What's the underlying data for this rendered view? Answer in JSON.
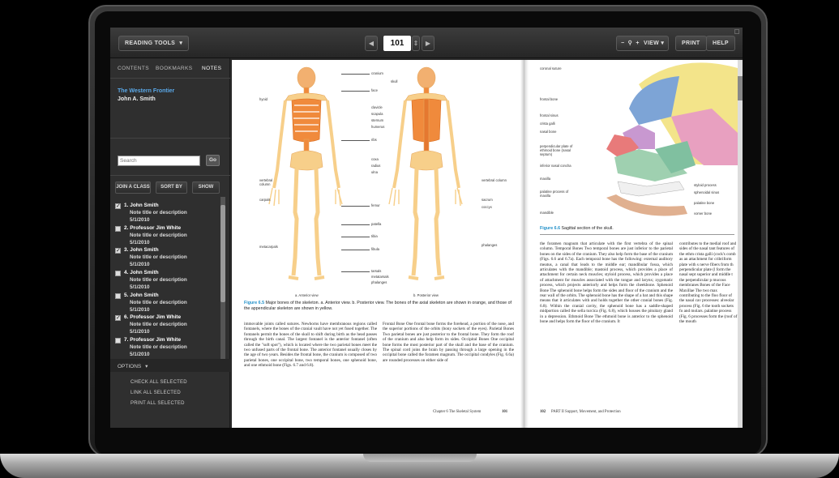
{
  "toolbar": {
    "reading_tools": "READING TOOLS",
    "current_page": "101",
    "view": "VIEW",
    "print": "PRINT",
    "help": "HELP",
    "zoom_out": "−",
    "zoom_in": "+"
  },
  "sidebar": {
    "tabs": [
      "CONTENTS",
      "BOOKMARKS",
      "NOTES"
    ],
    "active_tab": "NOTES",
    "book_title": "The Western Frontier",
    "book_author": "John A. Smith",
    "search_placeholder": "Search",
    "go_label": "Go",
    "buttons": [
      "JOIN A CLASS",
      "SORT BY",
      "SHOW"
    ],
    "notes": [
      {
        "name": "1. John Smith",
        "desc": "Note title or description",
        "date": "5/1/2010",
        "checked": true
      },
      {
        "name": "2. Professor Jim White",
        "desc": "Note title or description",
        "date": "5/1/2010",
        "checked": false
      },
      {
        "name": "3. John Smith",
        "desc": "Note title or description",
        "date": "5/1/2010",
        "checked": true
      },
      {
        "name": "4. John Smith",
        "desc": "Note title or description",
        "date": "5/1/2010",
        "checked": false
      },
      {
        "name": "5. John Smith",
        "desc": "Note title or description",
        "date": "5/1/2010",
        "checked": false
      },
      {
        "name": "6. Professor Jim White",
        "desc": "Note title or description",
        "date": "5/1/2010",
        "checked": true
      },
      {
        "name": "7. Professor Jim White",
        "desc": "Note title or description",
        "date": "5/1/2010",
        "checked": false
      }
    ],
    "options_label": "OPTIONS",
    "option_items": [
      "CHECK ALL SELECTED",
      "LINK ALL SELECTED",
      "PRINT ALL SELECTED"
    ]
  },
  "left_page": {
    "labels_left": [
      "hyoid",
      "vertebral column",
      "carpals",
      "metacarpals"
    ],
    "labels_center": [
      "cranium",
      "skull",
      "face",
      "clavicle",
      "scapula",
      "sternum",
      "humerus",
      "ribs",
      "coxa",
      "radius",
      "ulna",
      "femur",
      "patella",
      "tibia",
      "fibula",
      "tarsals",
      "metatarsals",
      "phalanges"
    ],
    "labels_right": [
      "vertebral column",
      "sacrum",
      "coccyx",
      "phalanges"
    ],
    "view_a": "a. Anterior view",
    "view_b": "b. Posterior view",
    "fig_num": "Figure 6.5",
    "fig_text": "Major bones of the skeleton. a. Anterior view. b. Posterior view. The bones of the axial skeleton are shown in orange, and those of the appendicular skeleton are shown in yellow.",
    "col1": "immovable joints called sutures. Newborns have membranous regions called fontanels, where the bones of the cranial vault have not yet fused together. The fontanels permit the bones of the skull to shift during birth as the head passes through the birth canal. The largest fontanel is the anterior fontanel (often called the \"soft spot\"), which is located where the two parietal bones meet the two unfused parts of the frontal bone. The anterior fontanel usually closes by the age of two years. Besides the frontal bone, the cranium is composed of two parietal bones, one occipital bone, two temporal bones, one sphenoid bone, and one ethmoid bone (Figs. 6.7 and 6.8).",
    "col2": "Frontal Bone One frontal bone forms the forehead, a portion of the nose, and the superior portions of the orbits (bony sockets of the eyes). Parietal Bones Two parietal bones are just posterior to the frontal bone. They form the roof of the cranium and also help form its sides. Occipital Bones One occipital bone forms the most posterior part of the skull and the base of the cranium. The spinal cord joins the brain by passing through a large opening in the occipital bone called the foramen magnum. The occipital condyles (Fig. 6.6a) are rounded processes on either side of",
    "footer": "Chapter 6  The Skeletal System",
    "page_num": "101"
  },
  "right_page": {
    "labels": [
      "coronal suture",
      "frontal bone",
      "frontal sinus",
      "crista galli",
      "nasal bone",
      "perpendicular plate of ethmoid bone (nasal septum)",
      "inferior nasal concha",
      "maxilla",
      "palatine process of maxilla",
      "mandible"
    ],
    "labels_r": [
      "styloid process",
      "sphenoidal sinus",
      "palatine bone",
      "vomer bone"
    ],
    "fig_num": "Figure 6.6",
    "fig_text": "Sagittal section of the skull.",
    "col1": "the foramen magnum that articulate with the first vertebra of the spinal column. Temporal Bones Two temporal bones are just inferior to the parietal bones on the sides of the cranium. They also help form the base of the cranium (Figs. 6.6 and 6.7a). Each temporal bone has the following: external auditory meatus, a canal that leads to the middle ear; mandibular fossa, which articulates with the mandible; mastoid process, which provides a place of attachment for certain neck muscles; styloid process, which provides a place of attachment for muscles associated with the tongue and larynx; zygomatic process, which projects anteriorly and helps form the cheekbone. Sphenoid Bone The sphenoid bone helps form the sides and floor of the cranium and the rear wall of the orbits. The sphenoid bone has the shape of a bat and this shape means that it articulates with and holds together the other cranial bones (Fig. 6.8). Within the cranial cavity, the sphenoid bone has a saddle-shaped midportion called the sella turcica (Fig. 6.8), which houses the pituitary gland in a depression. Ethmoid Bone The ethmoid bone is anterior to the sphenoid bone and helps form the floor of the cranium. It",
    "col2": "contributes to the medial roof and sides of the nasal tant features of the ethm crista galli (cock's comb as an attachment for cribriform plate with s nerve fibers from th perpendicular plate (l form the nasal sept superior and middle t the perpendicular p mucous membranes Bones of the Face Maxillae The two max contributing to the floo floor of the nasal cav processes: alveolar process (Fig. 6 the tooth sockets fo and molars. palatine process (Fig. 6 processes form the (roof of the mouth",
    "footer": "PART II  Support, Movement, and Protection",
    "page_num": "102"
  },
  "colors": {
    "accent_blue": "#1f8fc8",
    "title_blue": "#5aa8e8",
    "axial_orange": "#f08a3c",
    "appendicular_yellow": "#f7cf8a"
  }
}
